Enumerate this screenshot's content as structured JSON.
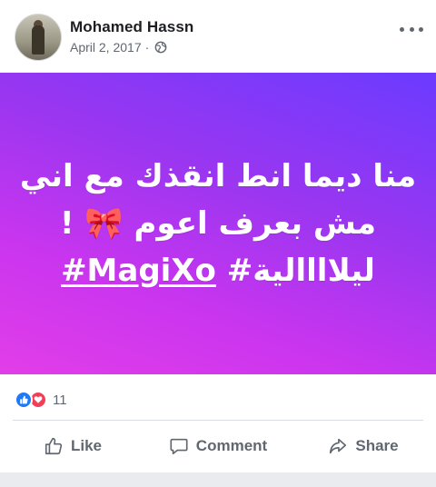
{
  "post": {
    "author": "Mohamed Hassn",
    "date": "April 2, 2017",
    "separator": "·",
    "privacy_icon": "globe-icon",
    "more_icon": "more-options-icon",
    "image": {
      "lines": [
        "منا ديما انط انقذك مع اني",
        "مش بعرف اعوم 🎀 !",
        "#MagiXo #ليلاااالية"
      ],
      "line3_hashtag_1": "#MagiXo",
      "line3_hashtag_2": "ليلاااالية#",
      "gradient_colors": [
        "#6b3bff",
        "#9b36f0",
        "#c935ef",
        "#e23ee8"
      ]
    }
  },
  "reactions": {
    "count": "11",
    "types": [
      "like",
      "love"
    ],
    "like_color": "#2078f4",
    "love_color": "#f33e58"
  },
  "actions": {
    "like_label": "Like",
    "comment_label": "Comment",
    "share_label": "Share"
  }
}
